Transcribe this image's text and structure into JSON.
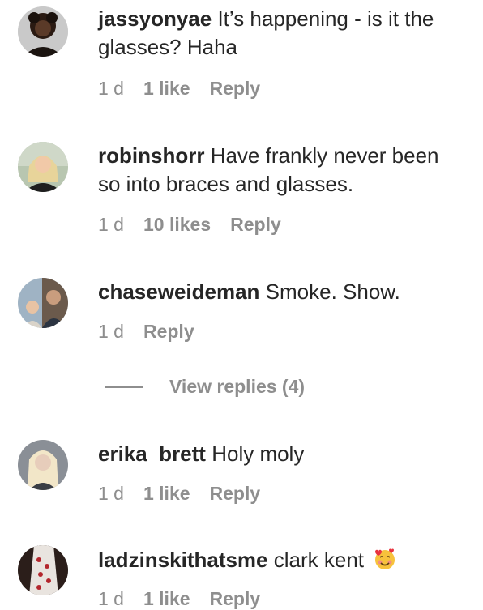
{
  "comments": [
    {
      "username": "jassyonyae",
      "text": "It’s happening - is it the glasses? Haha",
      "time": "1 d",
      "likes": "1 like",
      "reply": "Reply"
    },
    {
      "username": "robinshorr",
      "text": "Have frankly never been so into braces and glasses.",
      "time": "1 d",
      "likes": "10 likes",
      "reply": "Reply"
    },
    {
      "username": "chaseweideman",
      "text": "Smoke. Show.",
      "time": "1 d",
      "reply": "Reply"
    },
    {
      "username": "erika_brett",
      "text": "Holy moly",
      "time": "1 d",
      "likes": "1 like",
      "reply": "Reply"
    },
    {
      "username": "ladzinskithatsme",
      "text": "clark kent",
      "emoji": "smiling-face-with-hearts-icon",
      "time": "1 d",
      "likes": "1 like",
      "reply": "Reply"
    }
  ],
  "view_replies": "View replies (4)",
  "colors": {
    "text": "#262626",
    "secondary": "#8e8e8e",
    "background": "#ffffff"
  }
}
